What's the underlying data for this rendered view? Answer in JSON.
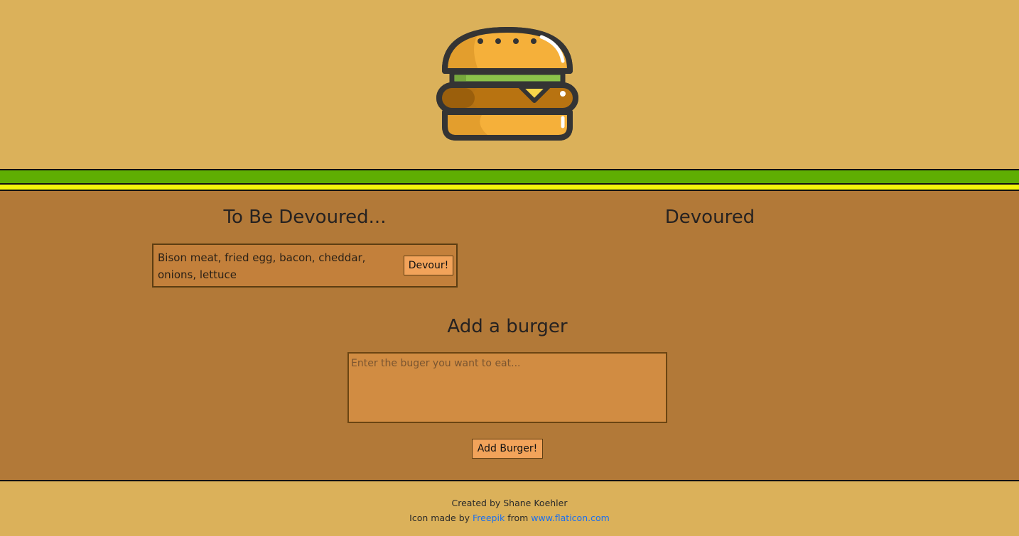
{
  "header": {
    "logo_icon": "burger-icon"
  },
  "columns": {
    "to_devour_title": "To Be Devoured...",
    "devoured_title": "Devoured"
  },
  "to_devour": [
    {
      "name": "Bison meat, fried egg, bacon, cheddar, onions, lettuce",
      "button_label": "Devour!"
    }
  ],
  "devoured": [],
  "add_form": {
    "title": "Add a burger",
    "placeholder": "Enter the buger you want to eat...",
    "value": "",
    "button_label": "Add Burger!"
  },
  "footer": {
    "created_by": "Created by Shane Koehler",
    "icon_prefix": "Icon made by",
    "author_link": "Freepik",
    "from_text": "from",
    "site_link": "www.flaticon.com"
  },
  "colors": {
    "page_bg": "#dbb15a",
    "main_bg": "#b27938",
    "stripe_green": "#5fae02",
    "stripe_yellow": "#f4f50a",
    "button_bg": "#f2a35a",
    "link": "#1a6ff0"
  }
}
